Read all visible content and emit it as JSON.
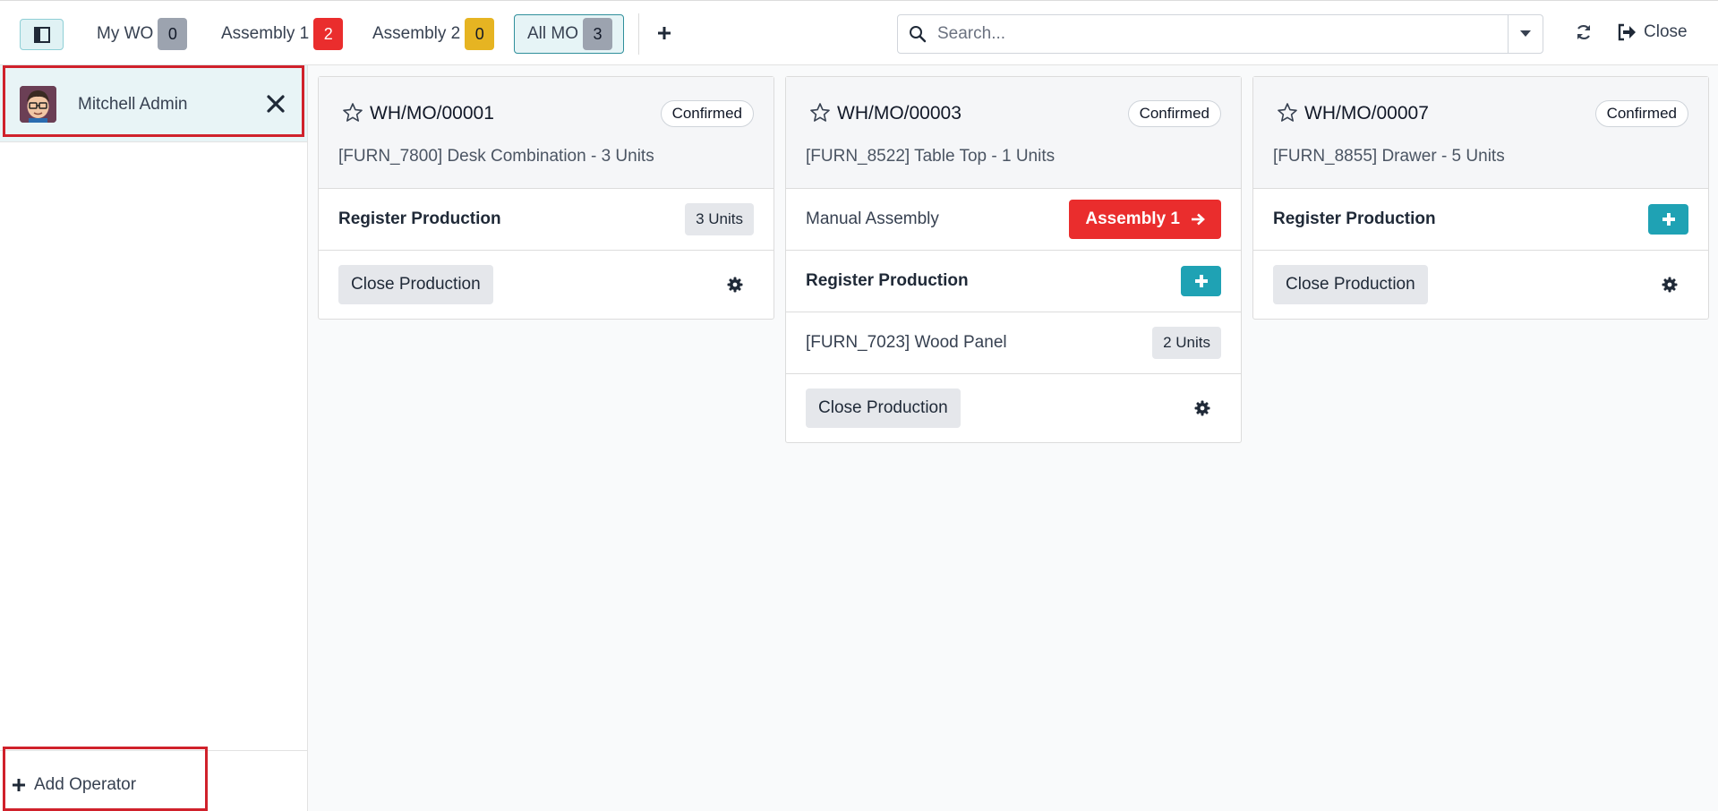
{
  "topbar": {
    "tabs": [
      {
        "label": "My WO",
        "count": "0",
        "color": "#9ca3af"
      },
      {
        "label": "Assembly 1",
        "count": "2",
        "color": "#ea2d2d"
      },
      {
        "label": "Assembly 2",
        "count": "0",
        "color": "#e6b422"
      },
      {
        "label": "All MO",
        "count": "3",
        "color": "#9ca3af",
        "active": true
      }
    ],
    "search_placeholder": "Search...",
    "close_label": "Close"
  },
  "operators": {
    "list": [
      {
        "name": "Mitchell Admin"
      }
    ],
    "add_label": "Add Operator"
  },
  "cards": [
    {
      "name": "WH/MO/00001",
      "state": "Confirmed",
      "product": "[FURN_7800] Desk Combination - 3 Units",
      "rows": [
        {
          "label": "Register Production",
          "pill": "3 Units"
        }
      ],
      "close_label": "Close Production"
    },
    {
      "name": "WH/MO/00003",
      "state": "Confirmed",
      "product": "[FURN_8522] Table Top - 1 Units",
      "rows": [
        {
          "label": "Manual Assembly",
          "workorder_button": "Assembly 1"
        },
        {
          "label": "Register Production"
        },
        {
          "label": "[FURN_7023] Wood Panel",
          "pill": "2 Units"
        }
      ],
      "close_label": "Close Production"
    },
    {
      "name": "WH/MO/00007",
      "state": "Confirmed",
      "product": "[FURN_8855] Drawer - 5 Units",
      "rows": [
        {
          "label": "Register Production"
        }
      ],
      "close_label": "Close Production"
    }
  ],
  "colors": {
    "accent": "#1fa2b4",
    "danger": "#ea2d2d",
    "warning": "#e6b422",
    "highlight_box": "#d0212b"
  }
}
